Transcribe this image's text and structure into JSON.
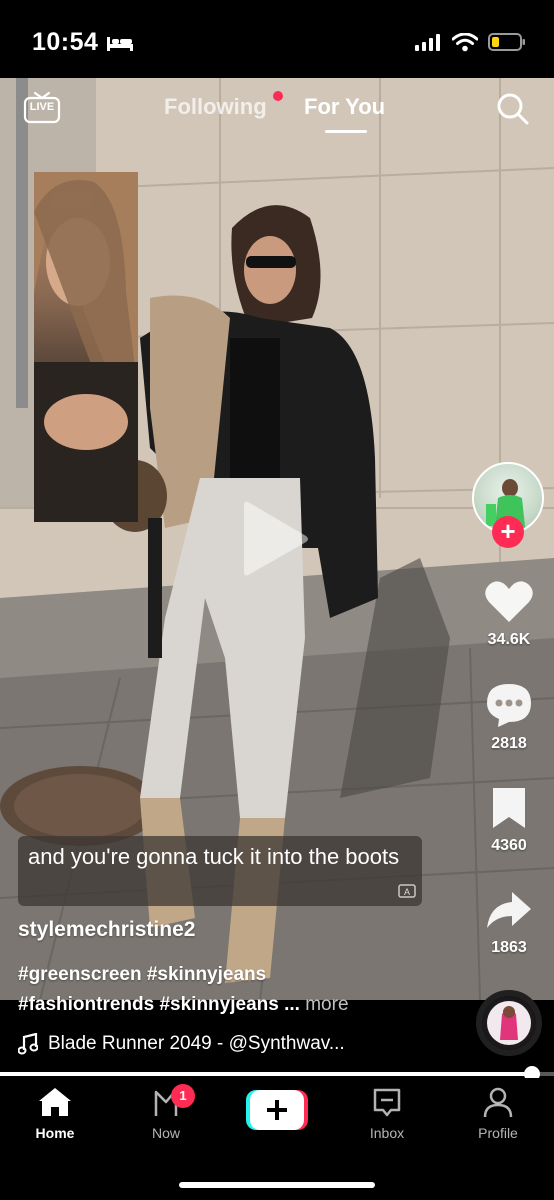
{
  "status_bar": {
    "time": "10:54"
  },
  "top_nav": {
    "live_label": "LIVE",
    "tab_following": "Following",
    "tab_for_you": "For You"
  },
  "actions": {
    "likes": "34.6K",
    "comments": "2818",
    "saves": "4360",
    "shares": "1863"
  },
  "caption": {
    "text": "and you're gonna tuck it into the boots"
  },
  "post": {
    "author": "stylemechristine2",
    "hashtags_line1": "#greenscreen #skinnyjeans",
    "hashtags_line2": "#fashiontrends #skinnyjeans ...",
    "more_label": " more"
  },
  "music": {
    "title": "Blade Runner 2049 - @Synthwav..."
  },
  "progress": {
    "value": 0.96
  },
  "bottom_nav": {
    "home": "Home",
    "now": "Now",
    "now_badge": "1",
    "inbox": "Inbox",
    "profile": "Profile"
  },
  "colors": {
    "accent": "#fe2c55",
    "create_cyan": "#25f4ee",
    "background": "#000000"
  },
  "icons": [
    "bed-icon",
    "signal-icon",
    "wifi-icon",
    "battery-icon",
    "live-icon",
    "search-icon",
    "play-icon",
    "heart-icon",
    "comment-icon",
    "bookmark-icon",
    "share-icon",
    "music-note-icon",
    "home-icon",
    "now-icon",
    "plus-icon",
    "inbox-icon",
    "profile-icon",
    "auto-caption-icon"
  ]
}
